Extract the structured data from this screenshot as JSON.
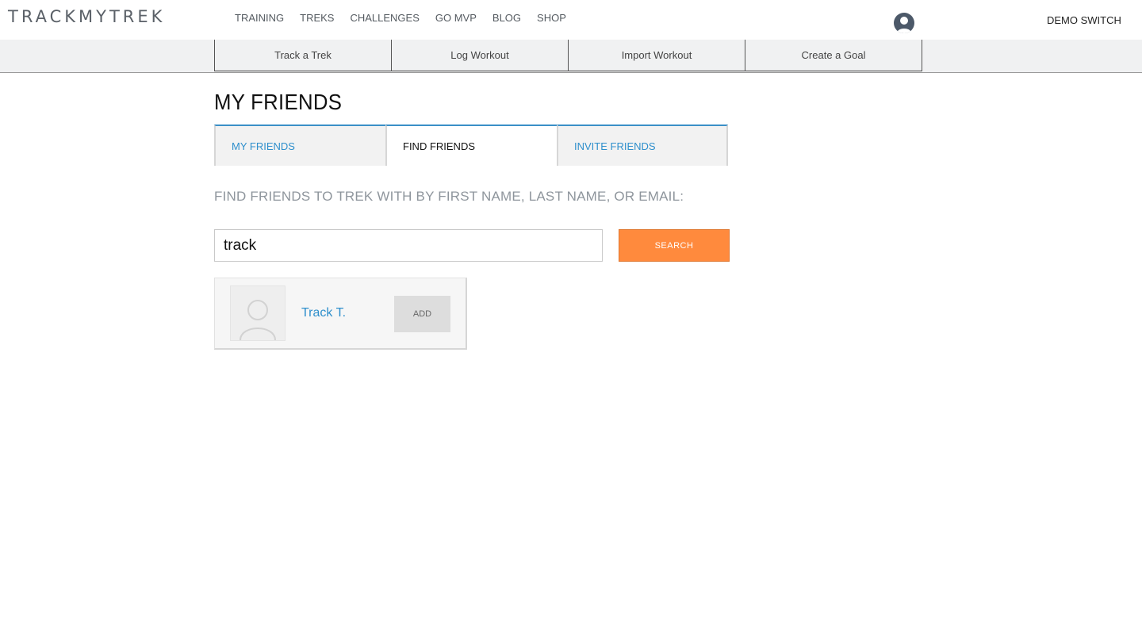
{
  "header": {
    "logo": "TRACKMYTREK",
    "nav": [
      "TRAINING",
      "TREKS",
      "CHALLENGES",
      "GO MVP",
      "BLOG",
      "SHOP"
    ],
    "user_name": "DEMO SWITCH"
  },
  "actions": [
    "Track a Trek",
    "Log Workout",
    "Import Workout",
    "Create a Goal"
  ],
  "page": {
    "title": "MY FRIENDS",
    "tabs": [
      {
        "label": "MY FRIENDS",
        "active": false
      },
      {
        "label": "FIND FRIENDS",
        "active": true
      },
      {
        "label": "INVITE FRIENDS",
        "active": false
      }
    ],
    "instructions": "FIND FRIENDS TO TREK WITH BY FIRST NAME, LAST NAME, OR EMAIL:",
    "search": {
      "value": "track",
      "button": "SEARCH"
    },
    "results": [
      {
        "name": "Track T.",
        "action": "ADD"
      }
    ]
  },
  "colors": {
    "accent_blue": "#2e8fcc",
    "search_orange": "#ff8a3d"
  }
}
